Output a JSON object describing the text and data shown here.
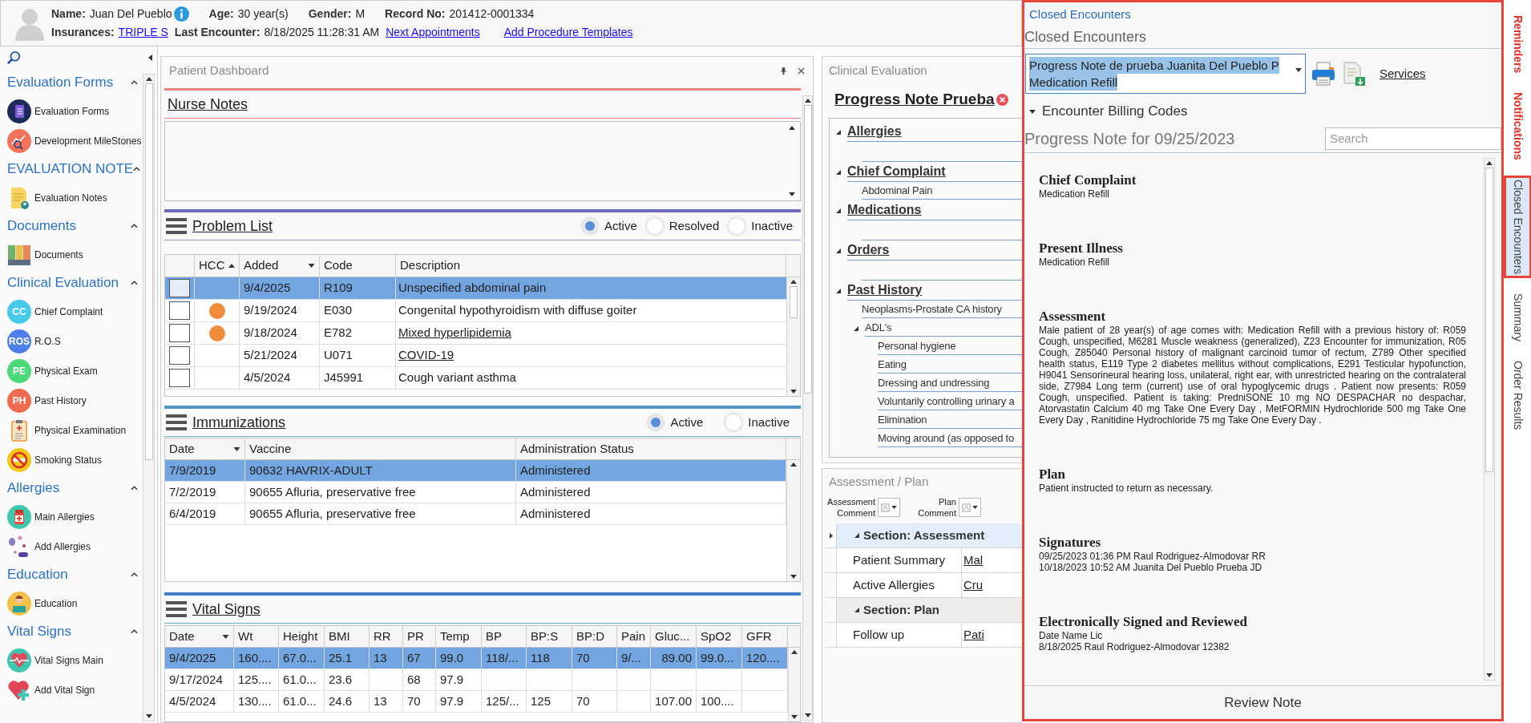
{
  "header": {
    "row_1": [
      {
        "label": "Name:",
        "value": "Juan Del Pueblo",
        "info": true
      },
      {
        "label": "Age:",
        "value": "30 year(s)",
        "info": false
      },
      {
        "label": "Gender:",
        "value": "M",
        "info": false
      },
      {
        "label": "Record No:",
        "value": "201412-0001334",
        "info": false
      }
    ],
    "row_2": [
      {
        "label": "Insurances:",
        "value": "TRIPLE S",
        "link": true
      },
      {
        "label": "Last Encounter:",
        "value": "8/18/2025 11:28:31 AM",
        "link": false
      }
    ],
    "links": [
      "Next Appointments",
      "Add Procedure Templates"
    ]
  },
  "sidebar": {
    "groups": [
      {
        "title": "Evaluation Forms",
        "expanded": true,
        "items": [
          {
            "label": "Evaluation Forms",
            "kind": "forms"
          },
          {
            "label": "Development MileStones",
            "kind": "milestones"
          }
        ]
      },
      {
        "title": "EVALUATION NOTE",
        "expanded": true,
        "items": [
          {
            "label": "Evaluation Notes",
            "kind": "note"
          }
        ]
      },
      {
        "title": "Documents",
        "expanded": true,
        "items": [
          {
            "label": "Documents",
            "kind": "binders"
          }
        ]
      },
      {
        "title": "Clinical Evaluation",
        "expanded": true,
        "items": [
          {
            "label": "Chief Complaint",
            "kind": "initials",
            "badge": "CC",
            "color": "#45cbe9"
          },
          {
            "label": "R.O.S",
            "kind": "initials",
            "badge": "ROS",
            "color": "#4f7fe8"
          },
          {
            "label": "Physical Exam",
            "kind": "initials",
            "badge": "PE",
            "color": "#4cd97b"
          },
          {
            "label": "Past History",
            "kind": "initials",
            "badge": "PH",
            "color": "#f06a50"
          },
          {
            "label": "Physical Examination",
            "kind": "clipboard"
          },
          {
            "label": "Smoking Status",
            "kind": "smoking"
          }
        ]
      },
      {
        "title": "Allergies",
        "expanded": true,
        "items": [
          {
            "label": "Main Allergies",
            "kind": "bottle"
          },
          {
            "label": "Add Allergies",
            "kind": "pills"
          }
        ]
      },
      {
        "title": "Education",
        "expanded": true,
        "items": [
          {
            "label": "Education",
            "kind": "reader"
          }
        ]
      },
      {
        "title": "Vital Signs",
        "expanded": true,
        "items": [
          {
            "label": "Vital Signs Main",
            "kind": "heartbeat"
          },
          {
            "label": "Add Vital Sign",
            "kind": "heartplus"
          }
        ]
      }
    ]
  },
  "dashboard": {
    "title": "Patient Dashboard",
    "nurse_notes": {
      "title": "Nurse Notes"
    },
    "problem_list": {
      "title": "Problem List",
      "filters": [
        {
          "label": "Active",
          "selected": true
        },
        {
          "label": "Resolved",
          "selected": false
        },
        {
          "label": "Inactive",
          "selected": false
        }
      ],
      "columns": [
        {
          "label": "HCC",
          "sorted": true,
          "menu": false
        },
        {
          "label": "Added",
          "sorted": false,
          "menu": true
        },
        {
          "label": "Code",
          "sorted": false,
          "menu": false
        },
        {
          "label": "Description",
          "sorted": false,
          "menu": false
        }
      ],
      "rows": [
        {
          "selected": true,
          "checked": false,
          "hcc": false,
          "added": "9/4/2025",
          "code": "R109",
          "description": "Unspecified abdominal pain",
          "link": false
        },
        {
          "selected": false,
          "checked": false,
          "hcc": true,
          "added": "9/19/2024",
          "code": "E030",
          "description": "Congenital hypothyroidism with diffuse goiter",
          "link": false
        },
        {
          "selected": false,
          "checked": false,
          "hcc": true,
          "added": "9/18/2024",
          "code": "E782",
          "description": "Mixed hyperlipidemia",
          "link": true
        },
        {
          "selected": false,
          "checked": false,
          "hcc": false,
          "added": "5/21/2024",
          "code": "U071",
          "description": "COVID-19",
          "link": true
        },
        {
          "selected": false,
          "checked": false,
          "hcc": false,
          "added": "4/5/2024",
          "code": "J45991",
          "description": "Cough variant asthma",
          "link": false
        }
      ]
    },
    "immunizations": {
      "title": "Immunizations",
      "filters": [
        {
          "label": "Active",
          "selected": true
        },
        {
          "label": "Inactive",
          "selected": false
        }
      ],
      "columns": [
        {
          "label": "Date",
          "menu": true
        },
        {
          "label": "Vaccine",
          "menu": false
        },
        {
          "label": "Administration Status",
          "menu": false
        }
      ],
      "rows": [
        {
          "selected": true,
          "cells": [
            "7/9/2019",
            "90632 HAVRIX-ADULT",
            "Administered"
          ]
        },
        {
          "selected": false,
          "cells": [
            "7/2/2019",
            "90655 Afluria, preservative free",
            "Administered"
          ]
        },
        {
          "selected": false,
          "cells": [
            "6/4/2019",
            "90655 Afluria, preservative free",
            "Administered"
          ]
        }
      ]
    },
    "vital_signs": {
      "title": "Vital Signs",
      "columns": [
        {
          "label": "Date",
          "menu": true
        },
        {
          "label": "Wt",
          "menu": false
        },
        {
          "label": "Height",
          "menu": false
        },
        {
          "label": "BMI",
          "menu": false
        },
        {
          "label": "RR",
          "menu": false
        },
        {
          "label": "PR",
          "menu": false
        },
        {
          "label": "Temp",
          "menu": false
        },
        {
          "label": "BP",
          "menu": false
        },
        {
          "label": "BP:S",
          "menu": false
        },
        {
          "label": "BP:D",
          "menu": false
        },
        {
          "label": "Pain",
          "menu": false
        },
        {
          "label": "Gluc...",
          "menu": false
        },
        {
          "label": "SpO2",
          "menu": false
        },
        {
          "label": "GFR",
          "menu": false
        }
      ],
      "rows": [
        {
          "selected": true,
          "cells": [
            "9/4/2025",
            "160....",
            "67.0...",
            "25.1",
            "13",
            "67",
            "99.0",
            "118/...",
            "118",
            "70",
            "9/...",
            "89.00",
            "99.0...",
            "120...."
          ]
        },
        {
          "selected": false,
          "cells": [
            "9/17/2024",
            "125....",
            "61.0...",
            "23.6",
            null,
            "68",
            "97.9",
            null,
            null,
            null,
            null,
            null,
            null,
            null
          ]
        },
        {
          "selected": false,
          "cells": [
            "4/5/2024",
            "130....",
            "61.0...",
            "24.6",
            "13",
            "70",
            "97.9",
            "125/...",
            "125",
            "70",
            null,
            "107.00",
            "100....",
            null
          ]
        }
      ]
    }
  },
  "clinical_evaluation": {
    "title": "Clinical Evaluation",
    "note_title": "Progress Note Prueba",
    "tree": [
      {
        "label": "Allergies",
        "expanded": true
      },
      {
        "label": "Chief Complaint",
        "expanded": true,
        "children": [
          {
            "label": "Abdominal Pain"
          }
        ]
      },
      {
        "label": "Medications",
        "expanded": true
      },
      {
        "label": "Orders",
        "expanded": true
      },
      {
        "label": "Past History",
        "expanded": true,
        "children": [
          {
            "label": "Neoplasms-Prostate CA history"
          },
          {
            "label": "ADL's",
            "expanded": true,
            "children": [
              {
                "label": "Personal hygiene"
              },
              {
                "label": "Eating"
              },
              {
                "label": "Dressing and undressing"
              },
              {
                "label": "Voluntarily controlling urinary a"
              },
              {
                "label": "Elimination"
              },
              {
                "label": "Moving around (as opposed to"
              }
            ]
          }
        ]
      }
    ]
  },
  "assessment_plan": {
    "title": "Assessment / Plan",
    "comments": [
      {
        "label": "Assessment Comment"
      },
      {
        "label": "Plan Comment"
      }
    ],
    "sections": [
      {
        "title": "Section: Assessment",
        "expanded": true,
        "selected": true,
        "rows": [
          {
            "label": "Patient Summary",
            "value": "Mal"
          },
          {
            "label": "Active Allergies",
            "value": "Cru"
          }
        ]
      },
      {
        "title": "Section: Plan",
        "expanded": true,
        "selected": false,
        "rows": [
          {
            "label": "Follow up",
            "value": "Pati"
          }
        ]
      }
    ]
  },
  "closed_encounters": {
    "breadcrumb": "Closed Encounters",
    "title": "Closed Encounters",
    "encounter": [
      "Progress Note de prueba Juanita Del Pueblo P",
      "Medication Refill"
    ],
    "services": "Services",
    "billing": {
      "label": "Encounter Billing Codes",
      "expanded": true
    },
    "note_title": "Progress Note for 09/25/2023",
    "search": {
      "placeholder": "Search"
    },
    "sections": [
      {
        "heading": "Chief Complaint",
        "lines": [
          "Medication Refill"
        ]
      },
      {
        "heading": "Present Illness",
        "lines": [
          "Medication Refill"
        ]
      },
      {
        "heading": "Assessment",
        "lines": [
          "Male patient of 28 year(s) of age comes with: Medication Refill with a previous history of: R059 Cough, unspecified, M6281 Muscle weakness (generalized), Z23 Encounter for immunization, R05 Cough, Z85040 Personal history of malignant carcinoid tumor of rectum, Z789 Other specified health status, E119 Type 2 diabetes mellitus without complications, E291 Testicular hypofunction, H9041 Sensorineural hearing loss, unilateral, right ear, with unrestricted hearing on the contralateral side, Z7984 Long term (current) use of oral hypoglycemic drugs . Patient now presents: R059 Cough, unspecified. Patient is taking: PredniSONE 10 mg NO DESPACHAR no despachar, Atorvastatin Calcium 40 mg Take One Every Day , MetFORMIN Hydrochloride 500 mg Take One Every Day , Ranitidine Hydrochloride 75 mg Take One Every Day ."
        ]
      },
      {
        "heading": "Plan",
        "lines": [
          "Patient instructed to return as necessary."
        ]
      },
      {
        "heading": "Signatures",
        "lines": [
          "09/25/2023 01:36 PM Raul Rodriguez-Almodovar RR",
          "10/18/2023 10:52 AM Juanita Del Pueblo Prueba JD"
        ]
      },
      {
        "heading": "Electronically Signed and Reviewed",
        "lines": [
          "Date Name Lic",
          "8/18/2025 Raul Rodriguez-Almodovar 12382"
        ]
      }
    ],
    "review_button": "Review Note"
  },
  "side_tabs": [
    {
      "label": "Reminders",
      "alert": true,
      "selected": false
    },
    {
      "label": "Notifications",
      "alert": true,
      "selected": false
    },
    {
      "label": "Closed Encounters",
      "alert": false,
      "selected": true
    },
    {
      "label": "Summary",
      "alert": false,
      "selected": false
    },
    {
      "label": "Order Results",
      "alert": false,
      "selected": false
    }
  ]
}
